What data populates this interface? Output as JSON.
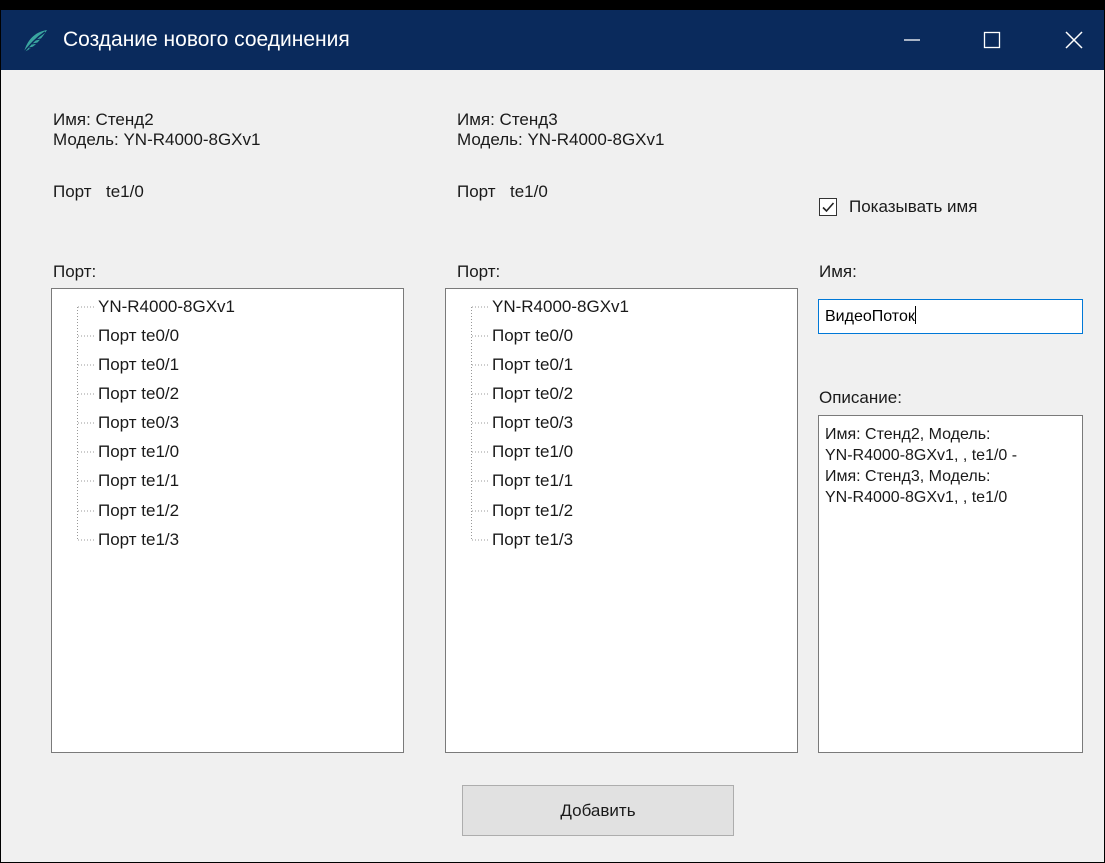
{
  "window": {
    "title": "Создание нового соединения",
    "title_bar_color": "#0a2a5c",
    "app_icon": "feather-logo-icon",
    "controls": [
      "minimize-icon",
      "maximize-icon",
      "close-icon"
    ]
  },
  "device1": {
    "name_line": "Имя: Стенд2",
    "model_line": "Модель: YN-R4000-8GXv1",
    "port_label": "Порт",
    "port_value": "te1/0",
    "tree_label": "Порт:",
    "tree": {
      "root": "YN-R4000-8GXv1",
      "items": [
        "Порт te0/0",
        "Порт te0/1",
        "Порт te0/2",
        "Порт te0/3",
        "Порт te1/0",
        "Порт te1/1",
        "Порт te1/2",
        "Порт te1/3"
      ]
    }
  },
  "device2": {
    "name_line": "Имя: Стенд3",
    "model_line": "Модель: YN-R4000-8GXv1",
    "port_label": "Порт",
    "port_value": "te1/0",
    "tree_label": "Порт:",
    "tree": {
      "root": "YN-R4000-8GXv1",
      "items": [
        "Порт te0/0",
        "Порт te0/1",
        "Порт te0/2",
        "Порт te0/3",
        "Порт te1/0",
        "Порт te1/1",
        "Порт te1/2",
        "Порт te1/3"
      ]
    }
  },
  "options": {
    "show_name_label": "Показывать имя",
    "show_name_checked": true
  },
  "name_field": {
    "label": "Имя:",
    "value": "ВидеоПоток"
  },
  "description": {
    "label": "Описание:",
    "lines": [
      "Имя: Стенд2, Модель:",
      "YN-R4000-8GXv1, , te1/0 -",
      "Имя: Стенд3, Модель:",
      "YN-R4000-8GXv1, , te1/0"
    ]
  },
  "actions": {
    "add_label": "Добавить"
  }
}
